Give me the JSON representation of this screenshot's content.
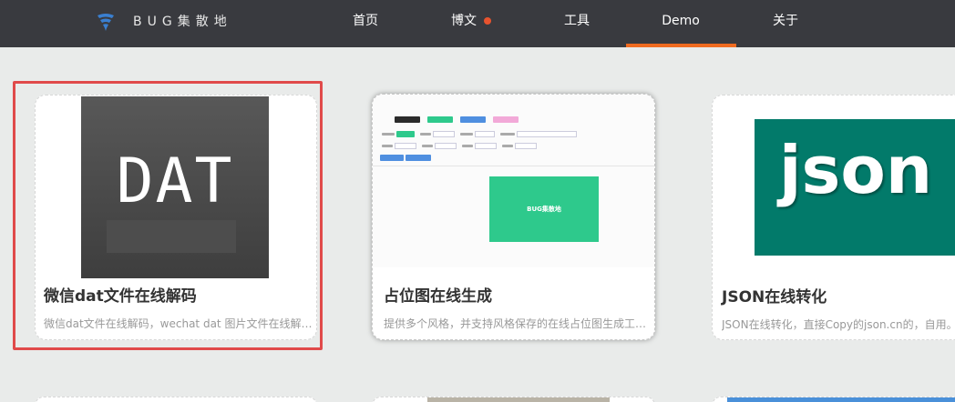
{
  "brand": {
    "name": "BUG集散地",
    "icon": "wifi-signal-icon",
    "icon_color": "#3a7fd0"
  },
  "nav": {
    "items": [
      {
        "label": "首页"
      },
      {
        "label": "博文",
        "dot_color": "#e8532e"
      },
      {
        "label": "工具"
      },
      {
        "label": "Demo",
        "active": true
      },
      {
        "label": "关于"
      }
    ],
    "active_underline_color": "#ef6a1f"
  },
  "cards": [
    {
      "title": "微信dat文件在线解码",
      "desc": "微信dat文件在线解码，wechat dat 图片文件在线解码...",
      "thumb": {
        "text": "DAT"
      },
      "selected": true
    },
    {
      "title": "占位图在线生成",
      "desc": "提供多个风格，并支持风格保存的在线占位图生成工具。",
      "thumb": {
        "preview_text": "BUG集散地"
      },
      "hovered": true
    },
    {
      "title": "JSON在线转化",
      "desc": "JSON在线转化，直接Copy的json.cn的，自用。",
      "thumb": {
        "text": "json"
      }
    }
  ],
  "colors": {
    "selection_border": "#e04a4a",
    "navbar_bg": "#393a3f",
    "page_bg": "#e9ebea",
    "placeholder_green": "#2ec98c",
    "json_teal": "#027a6a"
  }
}
